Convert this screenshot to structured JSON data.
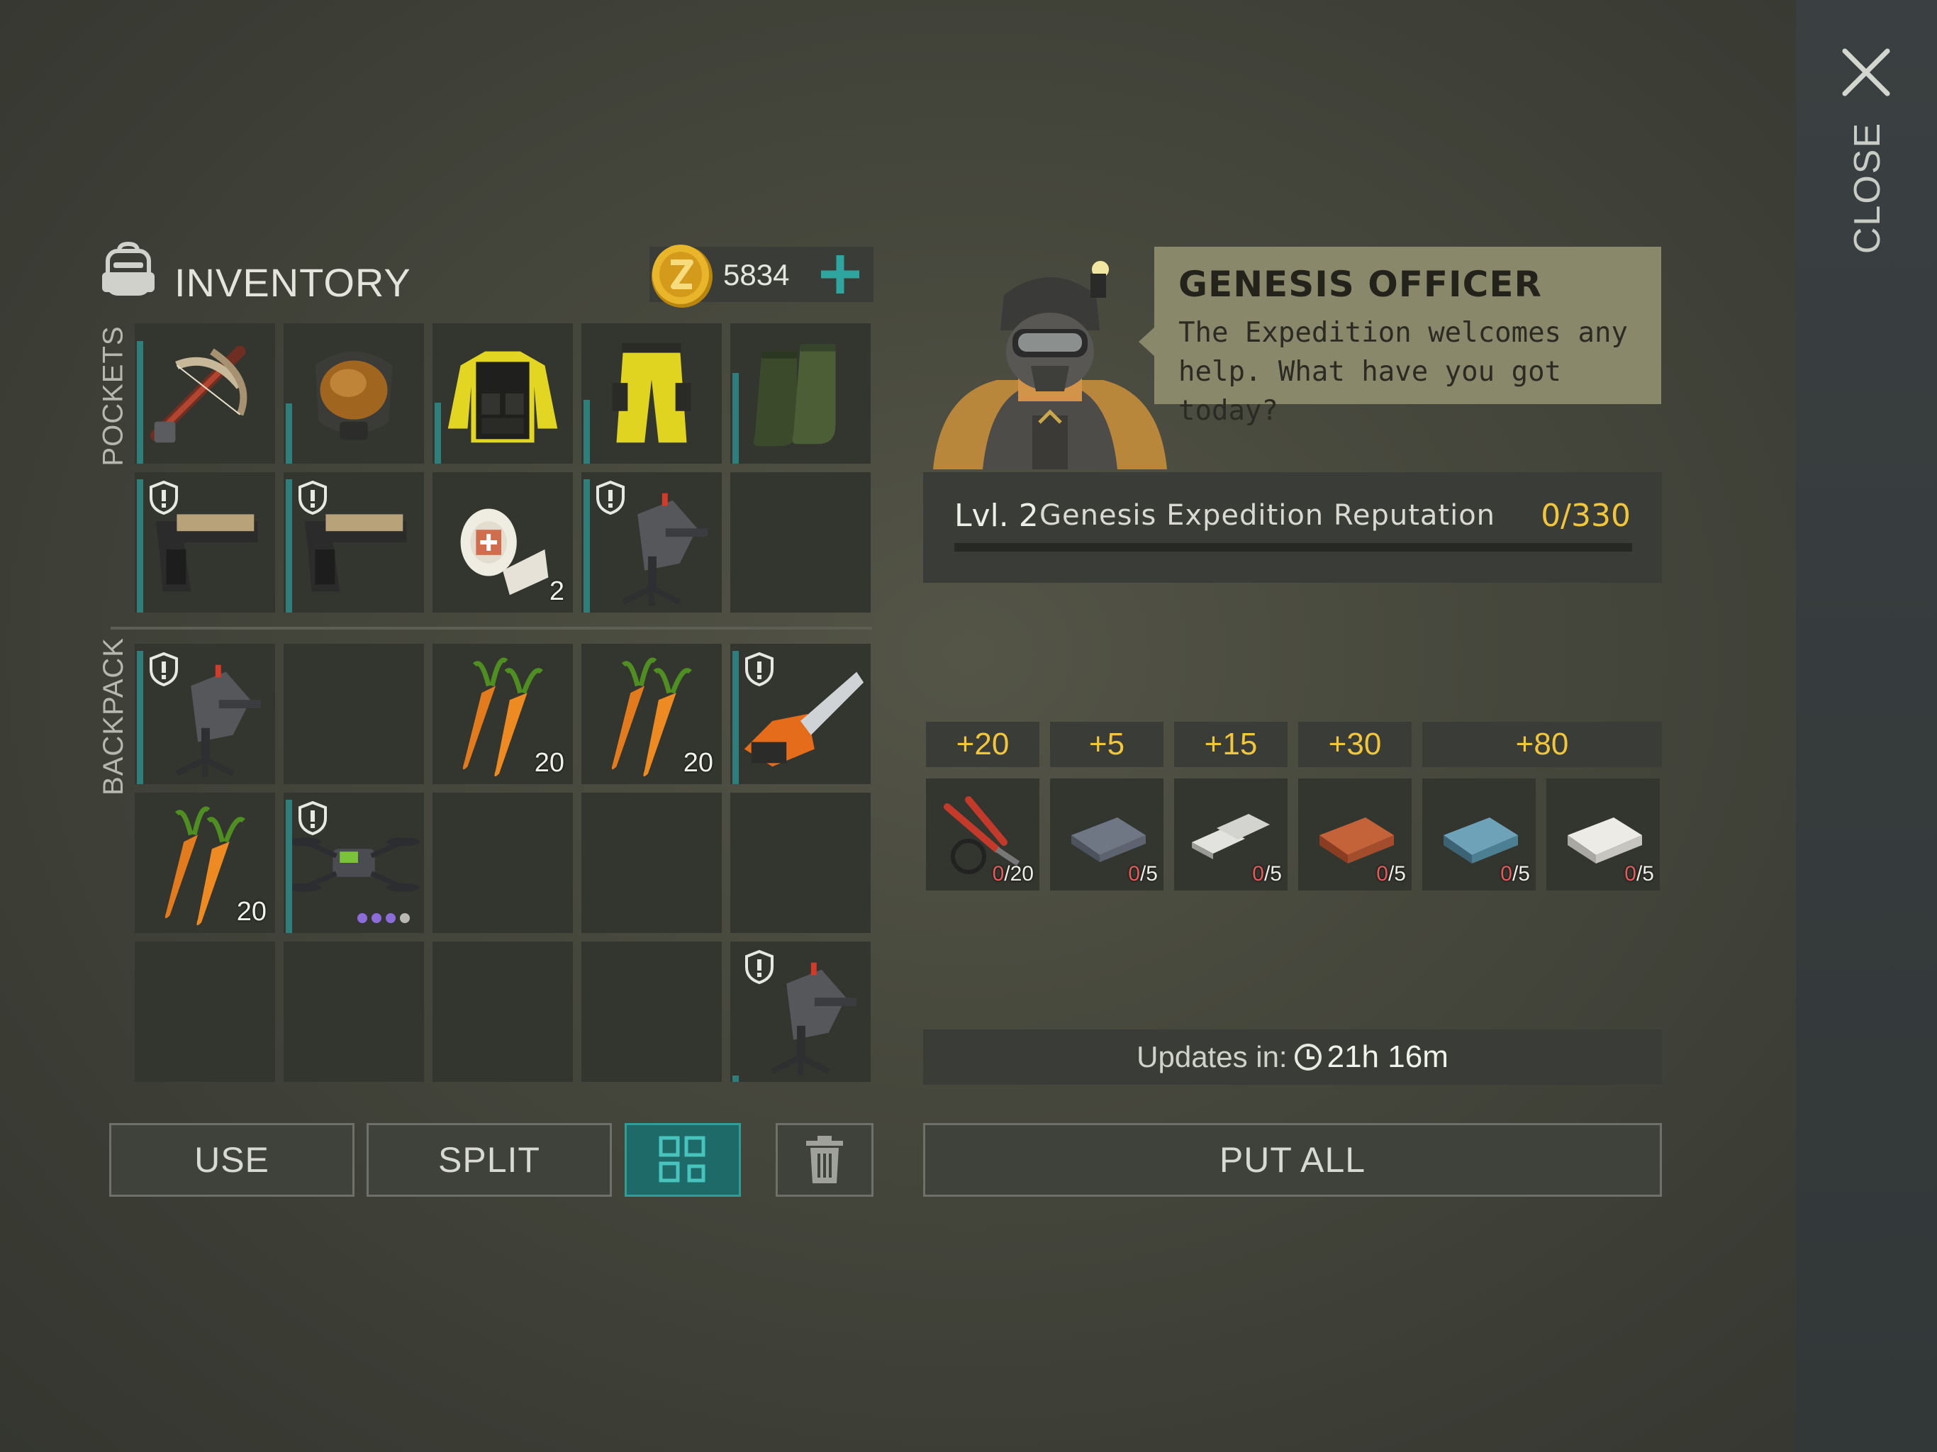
{
  "window": {
    "close_label": "CLOSE",
    "close_icon": "close-x-icon"
  },
  "inventory": {
    "title": "INVENTORY",
    "currency": {
      "value": "5834",
      "icon": "coin-icon",
      "add_icon": "plus-icon"
    },
    "pockets_label": "POCKETS",
    "backpack_label": "BACKPACK",
    "pockets": [
      {
        "item": "crossbow",
        "qty": "",
        "durability": 0.92
      },
      {
        "item": "gas-mask",
        "qty": "",
        "durability": 0.45
      },
      {
        "item": "tactical-jacket",
        "qty": "",
        "durability": 0.46
      },
      {
        "item": "hazmat-pants",
        "qty": "",
        "durability": 0.48
      },
      {
        "item": "rubber-boots",
        "qty": "",
        "durability": 0.68
      },
      {
        "item": "pistol",
        "qty": "",
        "durability": 1.0,
        "locked": true
      },
      {
        "item": "pistol",
        "qty": "",
        "durability": 1.0,
        "locked": true
      },
      {
        "item": "bandage",
        "qty": "2"
      },
      {
        "item": "turret",
        "qty": "",
        "durability": 1.0,
        "locked": true
      },
      {
        "item": "empty"
      }
    ],
    "backpack": [
      {
        "item": "turret",
        "qty": "",
        "durability": 1.0,
        "locked": true
      },
      {
        "item": "empty"
      },
      {
        "item": "carrots",
        "qty": "20"
      },
      {
        "item": "carrots",
        "qty": "20"
      },
      {
        "item": "chainsaw",
        "qty": "",
        "durability": 1.0,
        "locked": true
      },
      {
        "item": "carrots",
        "qty": "20"
      },
      {
        "item": "drone",
        "qty": "",
        "durability": 1.0,
        "locked": true,
        "charges": 4
      },
      {
        "item": "empty"
      },
      {
        "item": "empty"
      },
      {
        "item": "empty"
      },
      {
        "item": "empty"
      },
      {
        "item": "empty"
      },
      {
        "item": "empty"
      },
      {
        "item": "empty"
      },
      {
        "item": "turret",
        "qty": "",
        "durability": 0.05,
        "locked": true
      }
    ],
    "actions": {
      "use": "USE",
      "split": "SPLIT",
      "sort_icon": "sort-grid-icon",
      "trash_icon": "trash-icon"
    }
  },
  "officer": {
    "name": "GENESIS OFFICER",
    "message": "The Expedition welcomes any help. What have you got today?",
    "reputation": {
      "level": "Lvl. 2",
      "name": "Genesis Expedition Reputation",
      "value": "0/330",
      "progress": 0
    },
    "bonuses": [
      "+20",
      "+5",
      "+15",
      "+30",
      "+80"
    ],
    "requests": [
      {
        "item": "tools-pliers",
        "have": "0",
        "need": "/20"
      },
      {
        "item": "iron-ingot",
        "have": "0",
        "need": "/5"
      },
      {
        "item": "aluminum-ingot",
        "have": "0",
        "need": "/5"
      },
      {
        "item": "copper-ingot",
        "have": "0",
        "need": "/5"
      },
      {
        "item": "titanium-ingot",
        "have": "0",
        "need": "/5"
      },
      {
        "item": "silver-ingot",
        "have": "0",
        "need": "/5"
      }
    ],
    "updates_label": "Updates in:",
    "updates_time": "21h 16m",
    "put_all": "PUT ALL"
  },
  "colors": {
    "accent_teal": "#2e7f7b",
    "gold": "#f2c63a",
    "speech_bg": "#8a886b",
    "missing_red": "#e35a5a"
  }
}
